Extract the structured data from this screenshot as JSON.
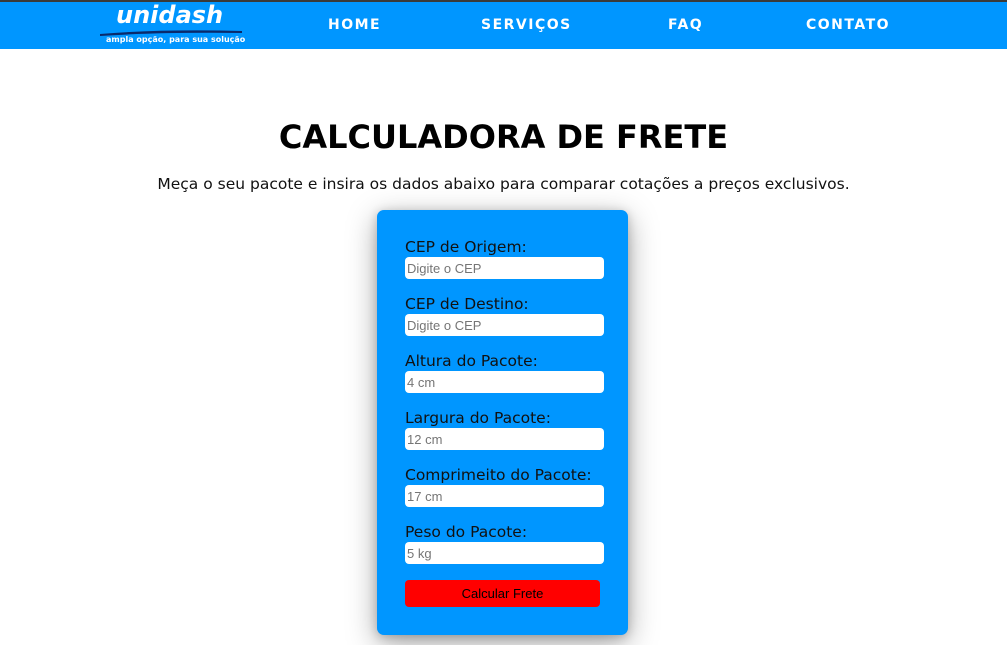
{
  "brand": {
    "name": "unidash",
    "tagline": "ampla opção, para sua solução"
  },
  "nav": {
    "items": [
      {
        "label": "HOME"
      },
      {
        "label": "SERVIÇOS"
      },
      {
        "label": "FAQ"
      },
      {
        "label": "CONTATO"
      }
    ]
  },
  "page": {
    "title": "CALCULADORA DE FRETE",
    "subtitle": "Meça o seu pacote e insira os dados abaixo para comparar cotações a preços exclusivos."
  },
  "form": {
    "fields": [
      {
        "label": "CEP de Origem:",
        "placeholder": "Digite o CEP",
        "value": ""
      },
      {
        "label": "CEP de Destino:",
        "placeholder": "Digite o CEP",
        "value": ""
      },
      {
        "label": "Altura do Pacote:",
        "placeholder": "4 cm",
        "value": ""
      },
      {
        "label": "Largura do Pacote:",
        "placeholder": "12 cm",
        "value": ""
      },
      {
        "label": "Comprimeito do Pacote:",
        "placeholder": "17 cm",
        "value": ""
      },
      {
        "label": "Peso do Pacote:",
        "placeholder": "5 kg",
        "value": ""
      }
    ],
    "submit_label": "Calcular Frete"
  },
  "colors": {
    "primary_blue": "#0096ff",
    "button_red": "#ff0000",
    "text_dark": "#000000",
    "background": "#ffffff"
  }
}
